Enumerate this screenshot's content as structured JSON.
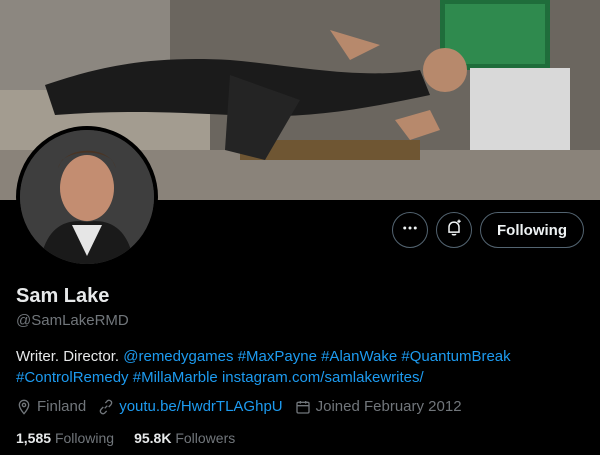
{
  "profile": {
    "name": "Sam Lake",
    "handle": "@SamLakeRMD",
    "bio": {
      "text": "Writer. Director. ",
      "tags": [
        "@remedygames",
        "#MaxPayne",
        "#AlanWake",
        "#QuantumBreak",
        "#ControlRemedy",
        "#MillaMarble"
      ],
      "link": "instagram.com/samlakewrites/"
    },
    "location": "Finland",
    "website": "youtu.be/HwdrTLAGhpU",
    "joined": "Joined February 2012",
    "following_count": "1,585",
    "following_label": "Following",
    "followers_count": "95.8K",
    "followers_label": "Followers"
  },
  "actions": {
    "more_icon": "more-icon",
    "notify_icon": "notification-bell-add-icon",
    "follow_label": "Following"
  },
  "colors": {
    "background": "#000000",
    "link": "#1d9bf0",
    "muted": "#71767b",
    "text": "#e7e9ea",
    "border": "#536471"
  }
}
